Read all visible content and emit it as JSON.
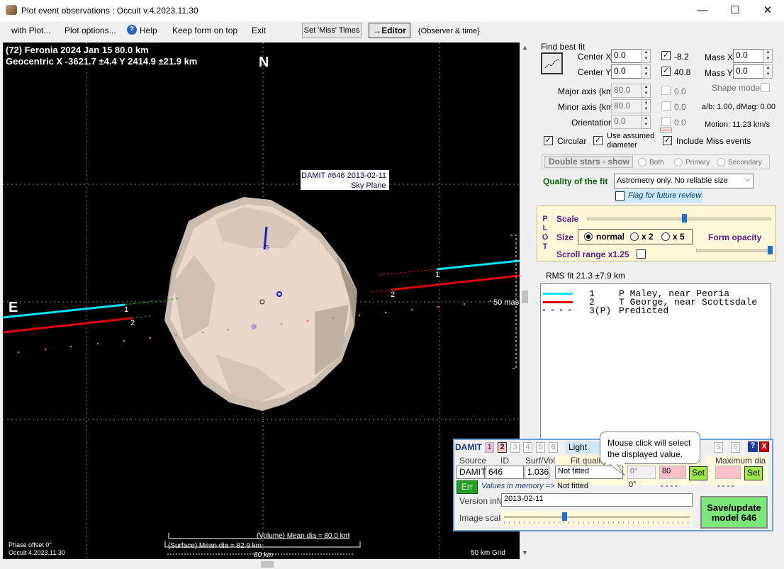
{
  "window": {
    "title": "Plot event observations : Occult v.4.2023.11.30",
    "minimize": "—",
    "maximize": "☐",
    "close": "✕"
  },
  "menu": {
    "with_plot": "with Plot...",
    "plot_options": "Plot options...",
    "help": "Help",
    "keep_form_on_top": "Keep form on top",
    "exit": "Exit"
  },
  "toolbar": {
    "set_miss_times": "Set 'Miss' Times",
    "editor": "→Editor",
    "observer_time": "{Observer & time}"
  },
  "plot": {
    "header_line1": "(72) Feronia  2024 Jan 15   80.0 km",
    "header_line2": "Geocentric  X  -3621.7 ±4.4  Y 2414.9 ±21.9 km",
    "north": "N",
    "east": "E",
    "model_label_1": "DAMIT #646 2013-02-11",
    "model_label_2": "Sky Plane",
    "chord1_label": "1",
    "chord2_label": "2",
    "scale_50mas": "50 mas",
    "volume_dia": "(Volume) Mean dia = 80.0 km",
    "surface_dia": "(Surface) Mean dia = 82.9 km",
    "km80": "80 km",
    "phase_offset": "Phase offset 0°",
    "version": "Occult 4.2023.11.30",
    "grid": "50 km Grid",
    "spin_label": "S"
  },
  "fit": {
    "find_best_fit": "Find best fit",
    "center_x_label": "Center X",
    "center_x": "0.0",
    "center_y_label": "Center Y",
    "center_y": "0.0",
    "x_result": "-8.2",
    "y_result": "40.8",
    "mass_x_label": "Mass X",
    "mass_x": "0.0",
    "mass_y_label": "Mass Y",
    "mass_y": "0.0",
    "major_label": "Major axis (km)",
    "major": "80.0",
    "major_result": "0.0",
    "minor_label": "Minor axis (km)",
    "minor": "80.0",
    "minor_result": "0.0",
    "orient_label": "Orientation",
    "orient": "0.0",
    "orient_result": "0.0",
    "shape_model": "Shape model",
    "ab_dmag": "a/b: 1.00, dMag: 0.00",
    "motion": "Motion: 11.23 km/s",
    "circular": "Circular",
    "use_assumed_1": "Use assumed",
    "use_assumed_2": "diameter",
    "include_miss": "Include Miss events",
    "double_stars": "Double stars - show",
    "both": "Both",
    "primary": "Primary",
    "secondary": "Secondary",
    "quality_label": "Quality of the fit",
    "quality_value": "Astrometry only. No reliable size",
    "flag_review": "Flag for future review"
  },
  "plotopts": {
    "plot_letters": [
      "P",
      "L",
      "O",
      "T"
    ],
    "scale": "Scale",
    "size": "Size",
    "normal": "normal",
    "x2": "x 2",
    "x5": "x 5",
    "form_opacity": "Form opacity",
    "scroll_range": "Scroll range x1.25",
    "scale_level": 0.53,
    "opacity_level": 1.0
  },
  "rms": "RMS fit 21.3 ±7.9 km",
  "legend": [
    {
      "num": "1",
      "name": "P Maley, near Peoria",
      "color": "#00e5ff"
    },
    {
      "num": "2",
      "name": "T George, near Scottsdale",
      "color": "#e00000"
    },
    {
      "num": "3(P)",
      "name": "Predicted",
      "color": "#e07080"
    }
  ],
  "damit": {
    "title": "DAMIT",
    "tabs": [
      "1",
      "2",
      "3",
      "4",
      "5",
      "6"
    ],
    "light_curves": "Light cur",
    "tabs2": [
      "5",
      "6"
    ],
    "help": "?",
    "close": "X",
    "source_h": "Source",
    "id_h": "ID",
    "surf_h": "Surf/Vol",
    "fit_quality_h": "Fit quality",
    "max_dia_h": "Maximum dia",
    "source": "DAMIT",
    "id": "646",
    "surf": "1.036",
    "fit_quality": "Not fitted",
    "fit_quality_mem": "Not fitted",
    "deg": "0°",
    "deg2": "0°",
    "min_dia": "80",
    "dashes": "- - - -",
    "dashes2": "- - - -",
    "set": "Set",
    "err": "Err",
    "values_in_memory": "Values in memory =>",
    "version_info": "Version info",
    "version": "2013-02-11",
    "image_scale": "Image scale",
    "image_scale_level": 0.32,
    "save_update": "Save/update",
    "model": "model 646"
  },
  "tooltip": "Mouse click will select the displayed value.",
  "colors": {
    "chord1": "#00e5ff",
    "chord2": "#e00000",
    "predicted": "#e07080",
    "asteroid": "#e8d6c8",
    "accent": "#006400"
  }
}
